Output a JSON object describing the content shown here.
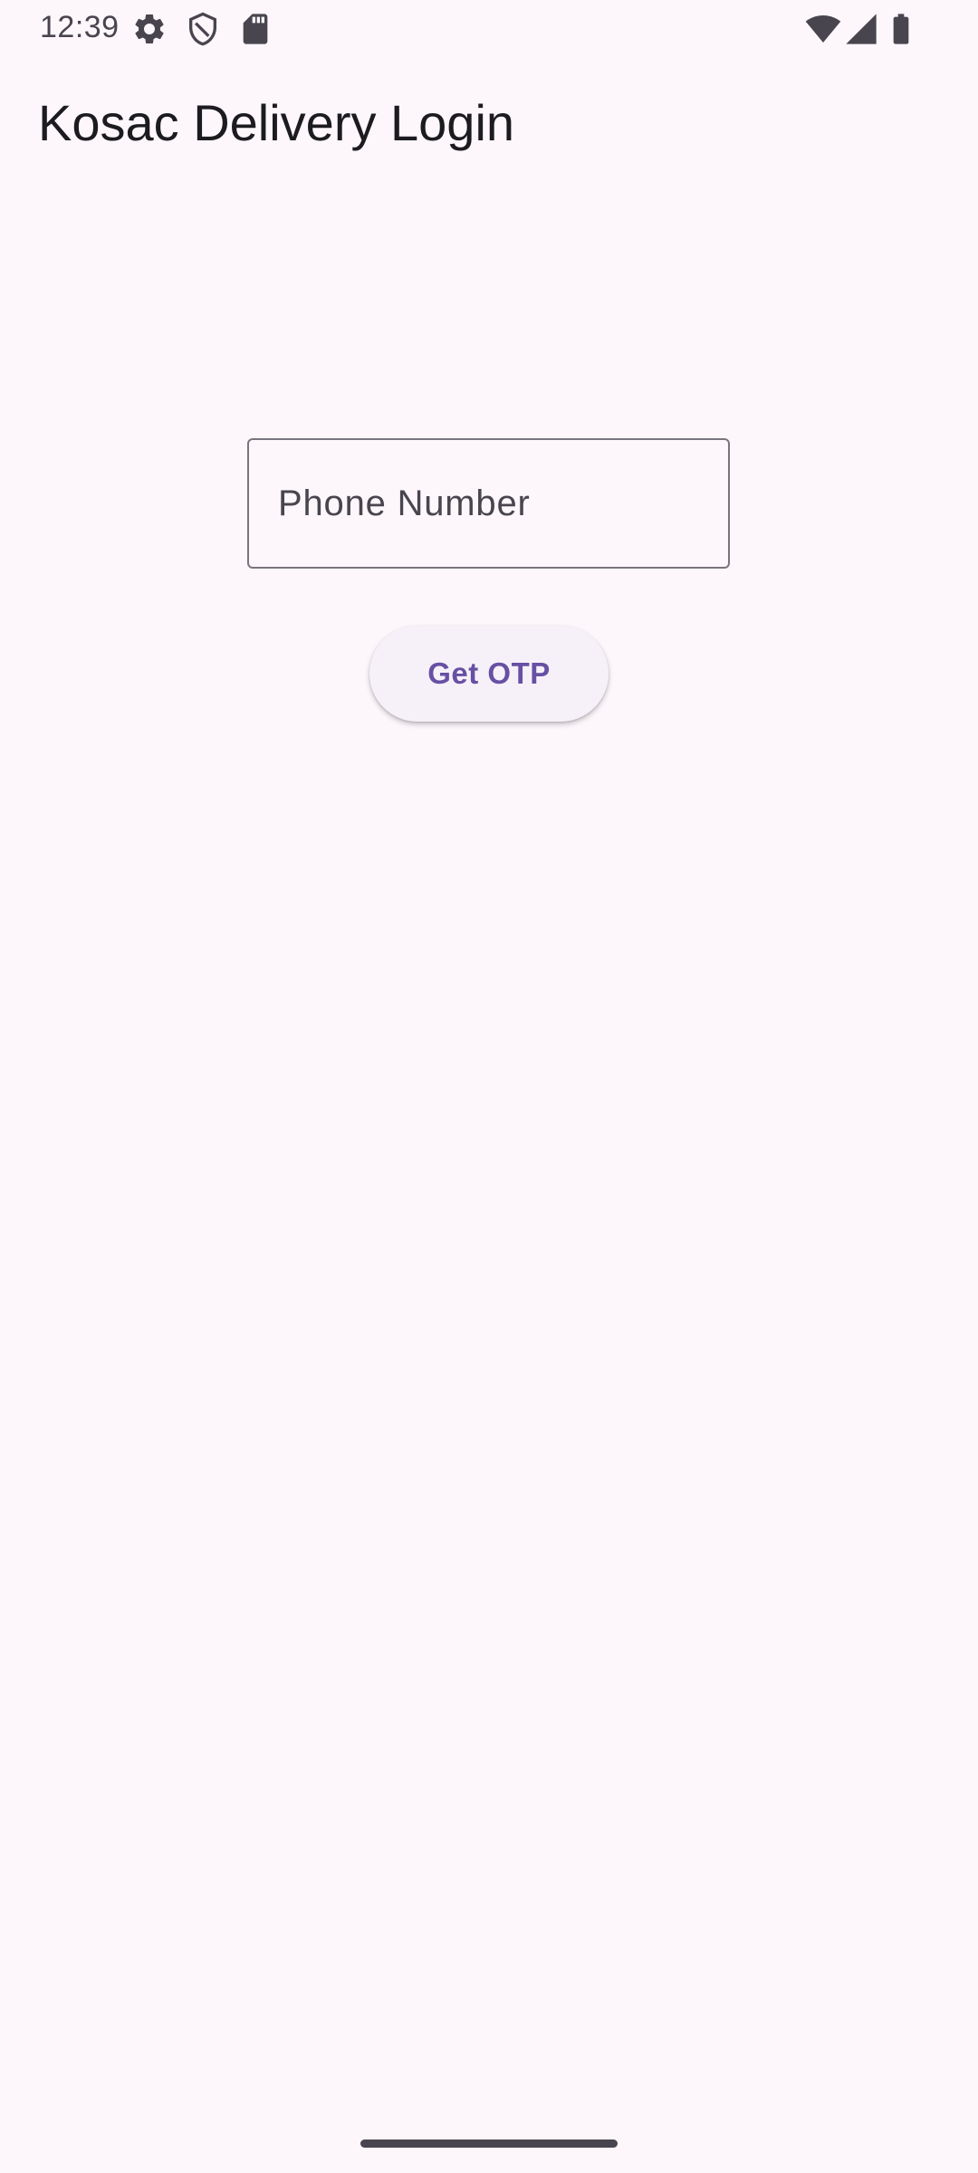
{
  "status_bar": {
    "time": "12:39",
    "left_icons": [
      "gear-icon",
      "shield-icon",
      "sd-card-icon"
    ],
    "right_icons": [
      "wifi-icon",
      "cell-signal-icon",
      "battery-icon"
    ],
    "icon_color": "#49454f"
  },
  "app_bar": {
    "title": "Kosac Delivery Login"
  },
  "login_form": {
    "phone_field": {
      "placeholder": "Phone Number",
      "value": ""
    },
    "get_otp_button": {
      "label": "Get OTP"
    }
  },
  "colors": {
    "background": "#fdf7fc",
    "primary": "#6750a4",
    "outline": "#79747e",
    "on_surface": "#1c1b1f"
  }
}
